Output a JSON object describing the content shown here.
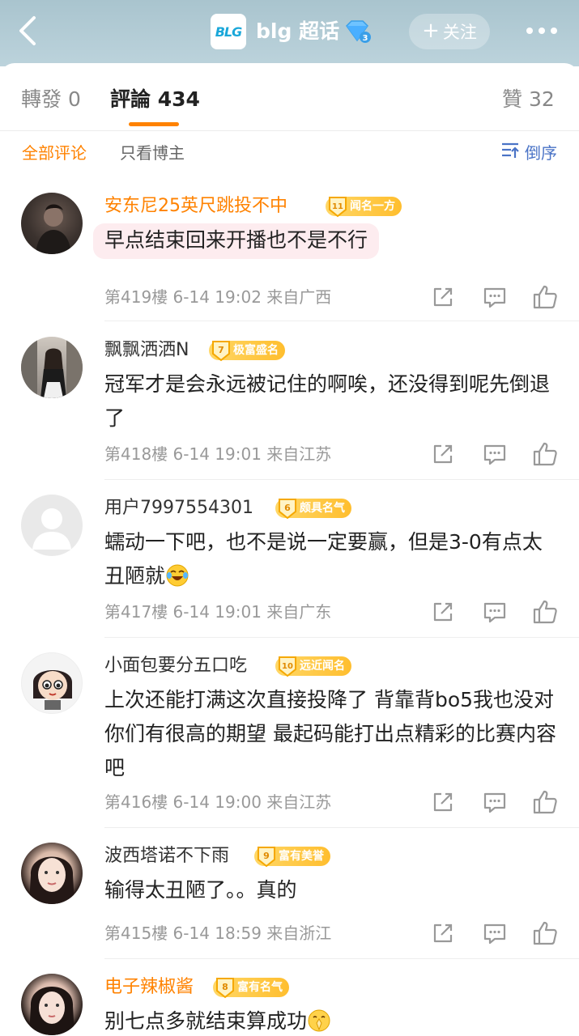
{
  "header": {
    "title": "blg 超话",
    "logo_text": "BLG",
    "follow_label": "关注"
  },
  "tabs": [
    {
      "label": "轉發",
      "count": "0"
    },
    {
      "label": "評論",
      "count": "434"
    },
    {
      "label": "贊",
      "count": "32"
    }
  ],
  "filters": {
    "all": "全部评论",
    "op_only": "只看博主",
    "sort": "倒序"
  },
  "comments": [
    {
      "name": "安东尼25英尺跳投不中",
      "medal_level": "11",
      "medal_text": "闻名一方",
      "text": "早点结束回来开播也不是不行",
      "meta": "第419樓 6-14 19:02 来自广西"
    },
    {
      "name": "飘飘洒洒N",
      "medal_level": "7",
      "medal_text": "极富盛名",
      "text": "冠军才是会永远被记住的啊唉，还没得到呢先倒退了",
      "meta": "第418樓 6-14 19:01 来自江苏"
    },
    {
      "name": "用户7997554301",
      "medal_level": "6",
      "medal_text": "颇具名气",
      "text": "蠕动一下吧，也不是说一定要赢，但是3-0有点太丑陋就",
      "meta": "第417樓 6-14 19:01 来自广东"
    },
    {
      "name": "小面包要分五口吃",
      "medal_level": "10",
      "medal_text": "远近闻名",
      "text": "上次还能打满这次直接投降了 背靠背bo5我也没对你们有很高的期望 最起码能打出点精彩的比赛内容吧",
      "meta": "第416樓 6-14 19:00 来自江苏"
    },
    {
      "name": "波西塔诺不下雨",
      "medal_level": "9",
      "medal_text": "富有美誉",
      "text": "输得太丑陋了。。真的",
      "meta": "第415樓 6-14 18:59 来自浙江"
    },
    {
      "name": "电子辣椒酱",
      "medal_level": "8",
      "medal_text": "富有名气",
      "text": "别七点多就结束算成功",
      "meta": ""
    }
  ]
}
